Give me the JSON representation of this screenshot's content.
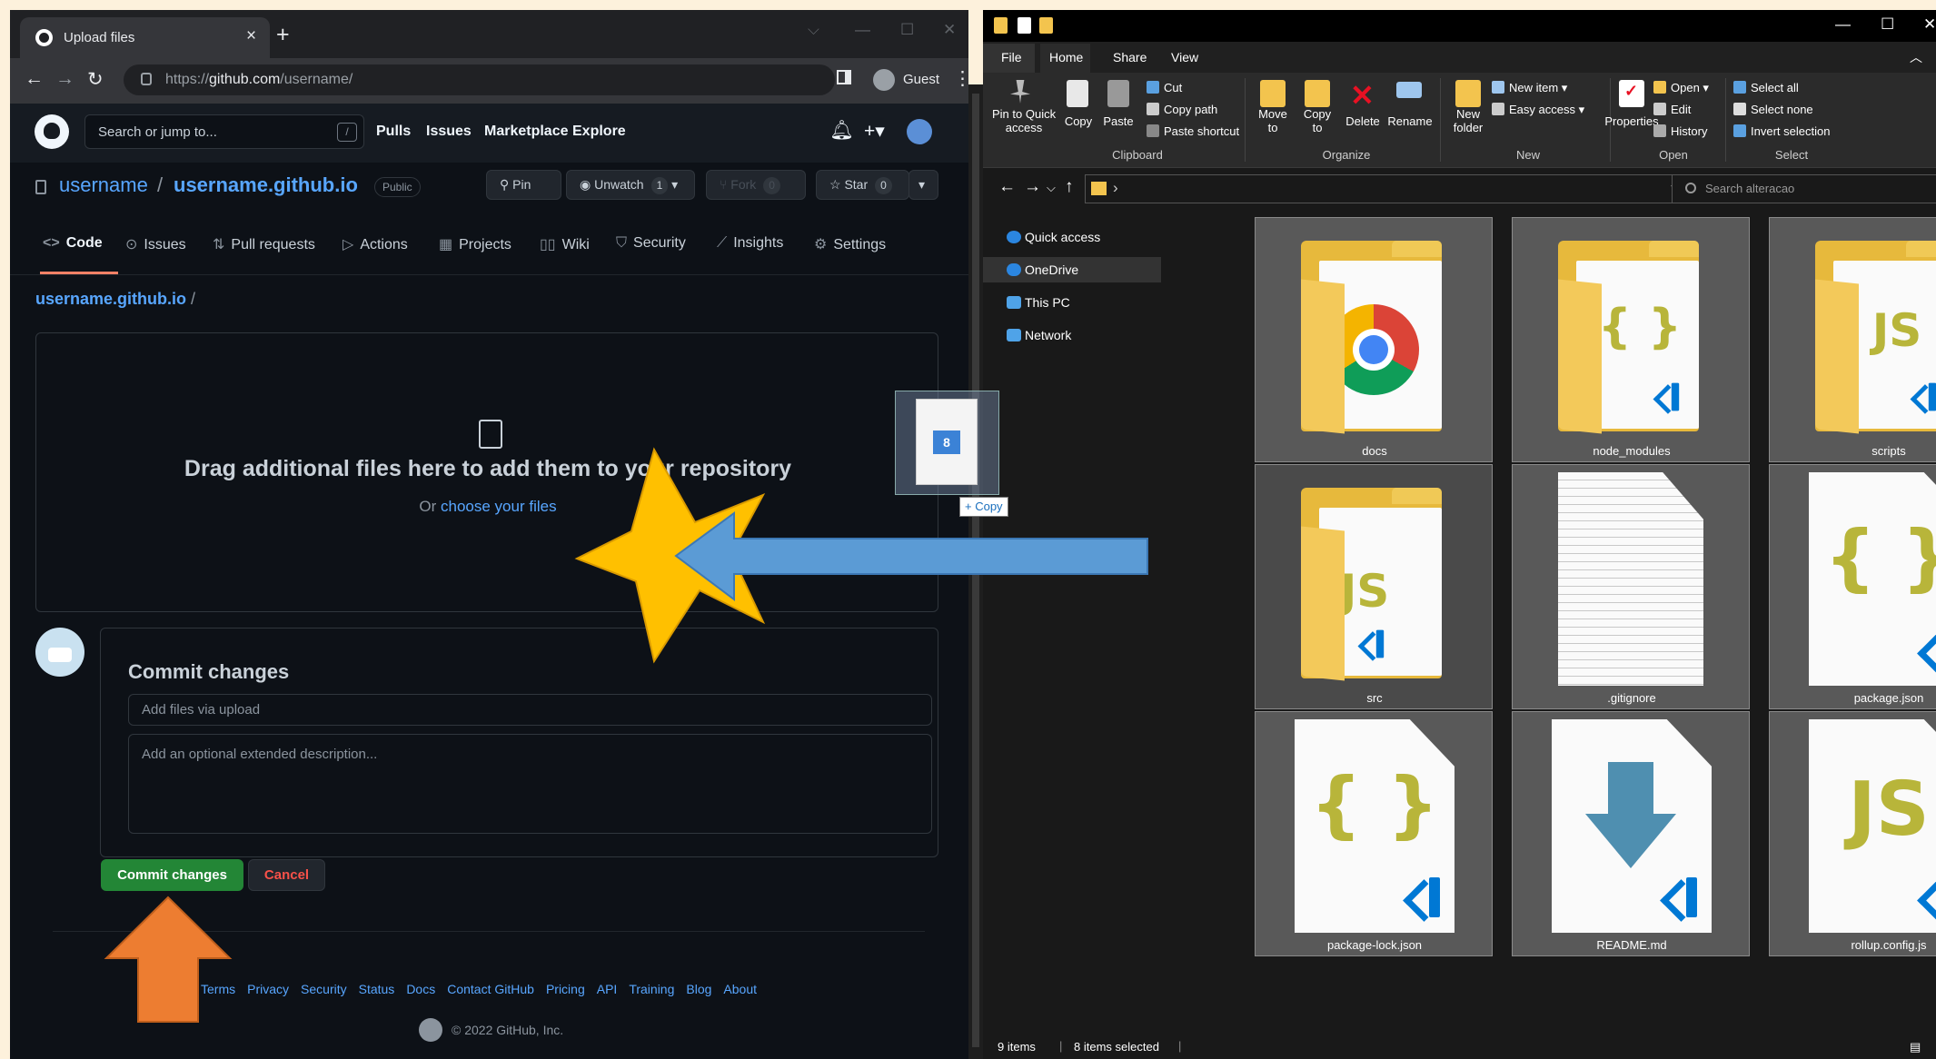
{
  "browser": {
    "tab_title": "Upload files",
    "tab_close": "×",
    "new_tab": "+",
    "url_prefix": "https://",
    "url_host": "github.com",
    "url_path": "/username/",
    "profile_name": "Guest"
  },
  "github": {
    "search_placeholder": "Search or jump to...",
    "search_shortcut": "/",
    "nav": [
      "Pulls",
      "Issues",
      "Marketplace",
      "Explore"
    ],
    "owner": "username",
    "slash": "/",
    "repo": "username.github.io",
    "visibility": "Public",
    "buttons": {
      "pin": "Pin",
      "unwatch": "Unwatch",
      "unwatch_count": "1",
      "fork": "Fork",
      "fork_count": "0",
      "star": "Star",
      "star_count": "0"
    },
    "tabs": [
      "Code",
      "Issues",
      "Pull requests",
      "Actions",
      "Projects",
      "Wiki",
      "Security",
      "Insights",
      "Settings"
    ],
    "breadcrumb_repo": "username.github.io",
    "breadcrumb_sep": "/",
    "drop_title": "Drag additional files here to add them to your repository",
    "drop_or": "Or",
    "drop_link": "choose your files",
    "commit_heading": "Commit changes",
    "summary_placeholder": "Add files via upload",
    "description_placeholder": "Add an optional extended description...",
    "commit_button": "Commit changes",
    "cancel_button": "Cancel",
    "footer_links": [
      "Terms",
      "Privacy",
      "Security",
      "Status",
      "Docs",
      "Contact GitHub",
      "Pricing",
      "API",
      "Training",
      "Blog",
      "About"
    ],
    "copyright": "© 2022 GitHub, Inc."
  },
  "explorer": {
    "menu_tabs": [
      "File",
      "Home",
      "Share",
      "View"
    ],
    "ribbon": {
      "pin": "Pin to Quick\naccess",
      "copy": "Copy",
      "paste": "Paste",
      "cut": "Cut",
      "copy_path": "Copy path",
      "paste_shortcut": "Paste shortcut",
      "group_clipboard": "Clipboard",
      "move_to": "Move\nto",
      "copy_to": "Copy\nto",
      "delete": "Delete",
      "rename": "Rename",
      "group_organize": "Organize",
      "new_folder": "New\nfolder",
      "new_item": "New item",
      "easy_access": "Easy access",
      "group_new": "New",
      "properties": "Properties",
      "open": "Open",
      "edit": "Edit",
      "history": "History",
      "group_open": "Open",
      "select_all": "Select all",
      "select_none": "Select none",
      "invert_selection": "Invert selection",
      "group_select": "Select"
    },
    "search_placeholder": "Search alteracao",
    "nav_items": [
      "Quick access",
      "OneDrive",
      "This PC",
      "Network"
    ],
    "files": [
      {
        "name": "docs",
        "kind": "folder",
        "glyph": ""
      },
      {
        "name": "node_modules",
        "kind": "folder",
        "glyph": "{ }"
      },
      {
        "name": "scripts",
        "kind": "folder",
        "glyph": "JS"
      },
      {
        "name": "src",
        "kind": "folder",
        "glyph": "JS"
      },
      {
        "name": ".gitignore",
        "kind": "text",
        "glyph": ""
      },
      {
        "name": "package.json",
        "kind": "json",
        "glyph": "{ }"
      },
      {
        "name": "package-lock.json",
        "kind": "json",
        "glyph": "{ }"
      },
      {
        "name": "README.md",
        "kind": "md",
        "glyph": ""
      },
      {
        "name": "rollup.config.js",
        "kind": "js",
        "glyph": "JS"
      }
    ],
    "status_items": "9 items",
    "status_selected": "8 items selected"
  },
  "drag": {
    "badge": "8",
    "tooltip": "+ Copy"
  },
  "colors": {
    "gh_bg": "#0d1117",
    "gh_link": "#58a6ff",
    "gh_green": "#238636",
    "arrow_blue": "#5b9bd5",
    "star_yellow": "#ffc000",
    "arrow_orange": "#ed7d31"
  }
}
